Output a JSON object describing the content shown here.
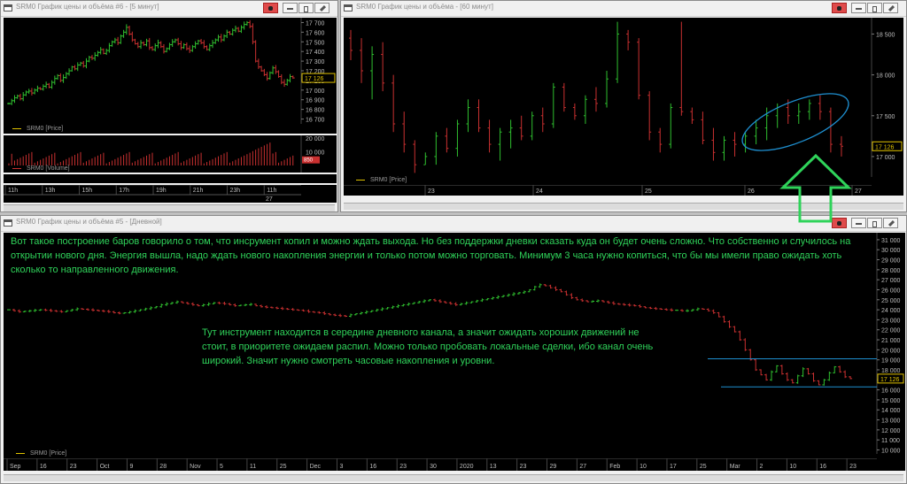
{
  "windows": {
    "w5min": {
      "title": "SRM0 График цены и объёма #6 - [5 минут]"
    },
    "w60": {
      "title": "SRM0 График цены и объёма - [60 минут]"
    },
    "wday": {
      "title": "SRM0 График цены и объёма #5 - [Дневной]"
    }
  },
  "legend": {
    "price": "SRM0 [Price]",
    "volume": "SRM0 [Volume]"
  },
  "badges": {
    "last_price": "17 126",
    "last_volume": "850"
  },
  "colors": {
    "up": "#2fbf2f",
    "down": "#c93030",
    "annotation": "#2fd35a",
    "channel": "#1e8fd0",
    "background": "#000000"
  },
  "annotations": {
    "top_note": "Вот такое построение баров говорило о том, что инсрумент копил и можно ждать выхода. Но без поддержки дневки сказать куда он будет очень сложно. Что собственно и случилось на открытии нового дня. Энергия вышла, надо ждать нового накопления энергии и только потом можно торговать. Минимум 3 часа нужно копиться, что бы мы имели право ожидать хоть сколько то направленного движения.",
    "mid_note": "Тут инструмент находится в середине дневного канала, а значит ожидать хороших движений не стоит, в приоритете ожидаем распил. Можно только пробовать локальные сделки, ибо канал очень широкий. Значит нужно смотреть часовые накопления и уровни."
  },
  "chart_data": [
    {
      "name": "SRM0 5 min",
      "type": "bar",
      "timeframe": "5 минут",
      "y_ticks": [
        "17 700",
        "17 600",
        "17 500",
        "17 400",
        "17 300",
        "17 200",
        "17 100",
        "17 000",
        "16 900",
        "16 800",
        "16 700"
      ],
      "y_range": [
        16650,
        17750
      ],
      "x_ticks": [
        "11h",
        "13h",
        "15h",
        "17h",
        "19h",
        "21h",
        "23h",
        "11h"
      ],
      "x_date": "27",
      "last_price": 17126,
      "closes": [
        16860,
        16890,
        16920,
        16940,
        16910,
        16950,
        16980,
        16990,
        16970,
        17000,
        17020,
        17010,
        17040,
        17060,
        17030,
        17080,
        17120,
        17150,
        17100,
        17130,
        17170,
        17200,
        17240,
        17220,
        17260,
        17280,
        17250,
        17300,
        17340,
        17330,
        17360,
        17390,
        17420,
        17380,
        17410,
        17460,
        17500,
        17520,
        17490,
        17560,
        17600,
        17650,
        17580,
        17520,
        17480,
        17450,
        17490,
        17470,
        17510,
        17440,
        17420,
        17460,
        17490,
        17450,
        17400,
        17430,
        17470,
        17500,
        17520,
        17480,
        17440,
        17470,
        17430,
        17410,
        17450,
        17480,
        17510,
        17490,
        17450,
        17420,
        17460,
        17490,
        17520,
        17550,
        17520,
        17560,
        17600,
        17580,
        17620,
        17640,
        17610,
        17650,
        17680,
        17700,
        17660,
        17500,
        17300,
        17240,
        17200,
        17160,
        17120,
        17180,
        17230,
        17190,
        17140,
        17080,
        17060,
        17100,
        17140,
        17126
      ],
      "volume": {
        "y_ticks": [
          "20 000",
          "10 000"
        ],
        "y_range": [
          0,
          22000
        ],
        "last": 850
      }
    },
    {
      "name": "SRM0 60 min",
      "type": "bar",
      "timeframe": "60 минут",
      "y_ticks": [
        "18 500",
        "18 000",
        "17 500",
        "17 000"
      ],
      "y_range": [
        16750,
        18700
      ],
      "x_ticks": [
        "23",
        "24",
        "25",
        "26",
        "27"
      ],
      "last_price": 17126,
      "bars": [
        [
          18450,
          18550,
          18180,
          18300
        ],
        [
          18300,
          18450,
          17900,
          18050
        ],
        [
          18050,
          18350,
          17700,
          18250
        ],
        [
          18250,
          18400,
          17800,
          17900
        ],
        [
          17900,
          18000,
          17300,
          17400
        ],
        [
          17400,
          17550,
          17050,
          17150
        ],
        [
          17150,
          17200,
          16800,
          16900
        ],
        [
          16900,
          17050,
          16900,
          17000
        ],
        [
          17000,
          17300,
          16900,
          17250
        ],
        [
          17250,
          17350,
          17050,
          17100
        ],
        [
          17100,
          17450,
          17000,
          17400
        ],
        [
          17400,
          17700,
          17300,
          17600
        ],
        [
          17600,
          17700,
          17300,
          17350
        ],
        [
          17350,
          17450,
          17050,
          17150
        ],
        [
          17150,
          17350,
          16950,
          17300
        ],
        [
          17300,
          17450,
          17100,
          17350
        ],
        [
          17350,
          17500,
          17200,
          17250
        ],
        [
          17250,
          17550,
          17200,
          17500
        ],
        [
          17500,
          17600,
          17300,
          17400
        ],
        [
          17400,
          17900,
          17350,
          17850
        ],
        [
          17850,
          17900,
          17550,
          17600
        ],
        [
          17600,
          17650,
          17450,
          17500
        ],
        [
          17500,
          17750,
          17400,
          17700
        ],
        [
          17700,
          17850,
          17550,
          17650
        ],
        [
          17650,
          18050,
          17600,
          17950
        ],
        [
          17950,
          18650,
          17900,
          18500
        ],
        [
          18500,
          18550,
          18300,
          18400
        ],
        [
          18400,
          18450,
          17700,
          17750
        ],
        [
          17750,
          17800,
          17200,
          17300
        ],
        [
          17300,
          17350,
          17050,
          17150
        ],
        [
          17150,
          17650,
          17100,
          17600
        ],
        [
          17600,
          18650,
          17500,
          17550
        ],
        [
          17550,
          17600,
          17400,
          17450
        ],
        [
          17450,
          17550,
          17150,
          17200
        ],
        [
          17200,
          17350,
          16950,
          17050
        ],
        [
          17050,
          17250,
          16950,
          17200
        ],
        [
          17200,
          17300,
          17000,
          17150
        ],
        [
          17150,
          17300,
          17050,
          17250
        ],
        [
          17250,
          17450,
          17150,
          17350
        ],
        [
          17350,
          17600,
          17200,
          17500
        ],
        [
          17500,
          17650,
          17350,
          17600
        ],
        [
          17600,
          17700,
          17400,
          17500
        ],
        [
          17500,
          17650,
          17400,
          17550
        ],
        [
          17550,
          17700,
          17450,
          17650
        ],
        [
          17650,
          17750,
          17450,
          17550
        ],
        [
          17550,
          17600,
          17050,
          17150
        ],
        [
          17150,
          17250,
          17000,
          17126
        ]
      ]
    },
    {
      "name": "SRM0 Daily",
      "type": "bar",
      "timeframe": "Дневной",
      "y_ticks": [
        "31 000",
        "30 000",
        "29 000",
        "28 000",
        "27 000",
        "26 000",
        "25 000",
        "24 000",
        "23 000",
        "22 000",
        "21 000",
        "20 000",
        "19 000",
        "18 000",
        "17 000",
        "16 000",
        "15 000",
        "14 000",
        "13 000",
        "12 000",
        "11 000",
        "10 000"
      ],
      "y_range": [
        9600,
        31700
      ],
      "x_ticks": [
        "Sep",
        "16",
        "23",
        "Oct",
        "9",
        "28",
        "Nov",
        "5",
        "11",
        "25",
        "Dec",
        "3",
        "16",
        "23",
        "30",
        "2020",
        "13",
        "23",
        "29",
        "27",
        "Feb",
        "10",
        "17",
        "25",
        "Mar",
        "2",
        "10",
        "16",
        "23"
      ],
      "last_price": 17126,
      "levels": [
        19100,
        16300
      ],
      "closes": [
        24000,
        23900,
        23800,
        23850,
        23900,
        23950,
        24000,
        23950,
        23900,
        23850,
        23800,
        23900,
        24000,
        24100,
        24050,
        24000,
        23950,
        23900,
        23850,
        23800,
        23700,
        23650,
        23700,
        23800,
        23900,
        24000,
        24100,
        24200,
        24300,
        24500,
        24600,
        24700,
        24800,
        24700,
        24600,
        24500,
        24400,
        24500,
        24600,
        24700,
        24650,
        24600,
        24500,
        24400,
        24450,
        24500,
        24550,
        24400,
        24300,
        24250,
        24200,
        24150,
        24100,
        24050,
        24000,
        23950,
        23900,
        23800,
        23750,
        23700,
        23600,
        23500,
        23450,
        23400,
        23350,
        23500,
        23600,
        23700,
        23800,
        23900,
        24000,
        24100,
        24200,
        24300,
        24400,
        24500,
        24600,
        24700,
        24800,
        24900,
        25000,
        24900,
        24800,
        24700,
        24600,
        24500,
        24600,
        24700,
        24800,
        24900,
        25000,
        25100,
        25200,
        25300,
        25400,
        25500,
        25600,
        25700,
        25800,
        26000,
        26300,
        26500,
        26400,
        26200,
        26000,
        25800,
        25500,
        25200,
        25000,
        24900,
        24800,
        24850,
        24900,
        24800,
        24700,
        24600,
        24550,
        24500,
        24450,
        24400,
        24300,
        24200,
        24150,
        24100,
        24050,
        24000,
        23950,
        23950,
        23900,
        23900,
        24000,
        24100,
        24050,
        23900,
        23700,
        23300,
        22800,
        22300,
        21800,
        21000,
        20000,
        19000,
        18000,
        17500,
        17000,
        17800,
        18400,
        17600,
        17000,
        16700,
        17400,
        18100,
        17600,
        16900,
        16500,
        17000,
        17700,
        18300,
        17800,
        17300,
        17126
      ]
    }
  ]
}
